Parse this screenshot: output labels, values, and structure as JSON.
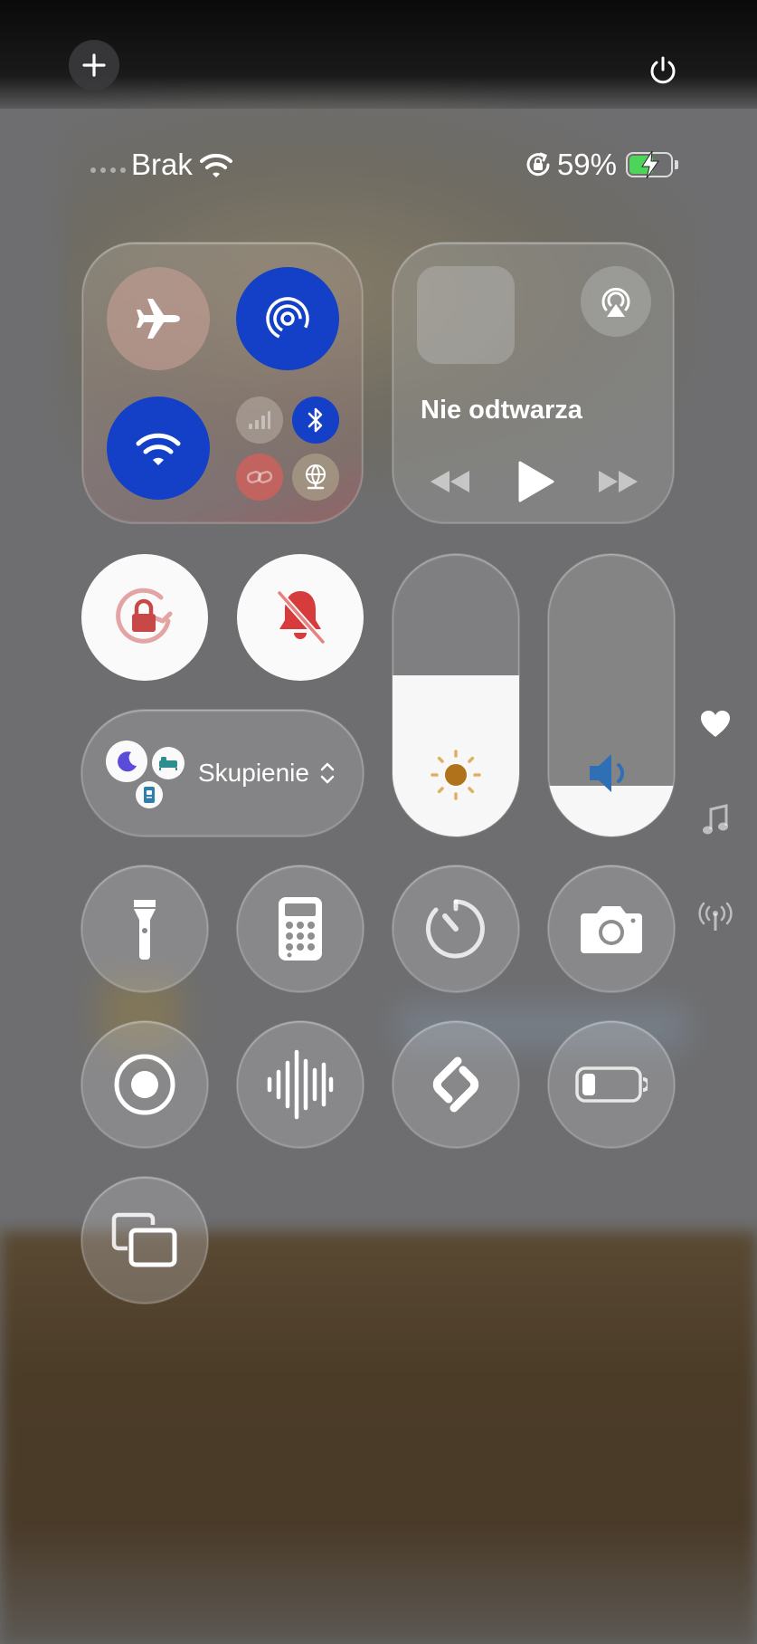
{
  "status_bar": {
    "carrier": "Brak",
    "battery_percent": "59%",
    "battery_level": 0.59,
    "charging": true
  },
  "top_controls": {
    "add_icon": "plus-icon",
    "power_icon": "power-icon"
  },
  "connectivity": {
    "airplane_mode": false,
    "airdrop": true,
    "wifi": true,
    "cellular": false,
    "bluetooth": true,
    "hotspot": false,
    "vpn": false
  },
  "media": {
    "title": "Nie odtwarza"
  },
  "focus": {
    "label": "Skupienie"
  },
  "sliders": {
    "brightness_level": 0.57,
    "volume_level": 0.18
  },
  "colors": {
    "accent_blue": "#1340c6",
    "mute_red": "#d63c3c",
    "lock_red": "#c84848",
    "brightness_sun": "#b0731c",
    "volume_blue": "#2f6fb6",
    "focus_moon": "#5a4bd8",
    "focus_bed": "#2d8d8f"
  },
  "side_indicators": [
    "heart-icon",
    "music-note-icon",
    "antenna-icon"
  ],
  "tiles": [
    "flashlight-icon",
    "calculator-icon",
    "timer-icon",
    "camera-icon",
    "screen-record-icon",
    "voice-memo-icon",
    "shazam-icon",
    "low-power-icon",
    "screen-mirroring-icon"
  ]
}
